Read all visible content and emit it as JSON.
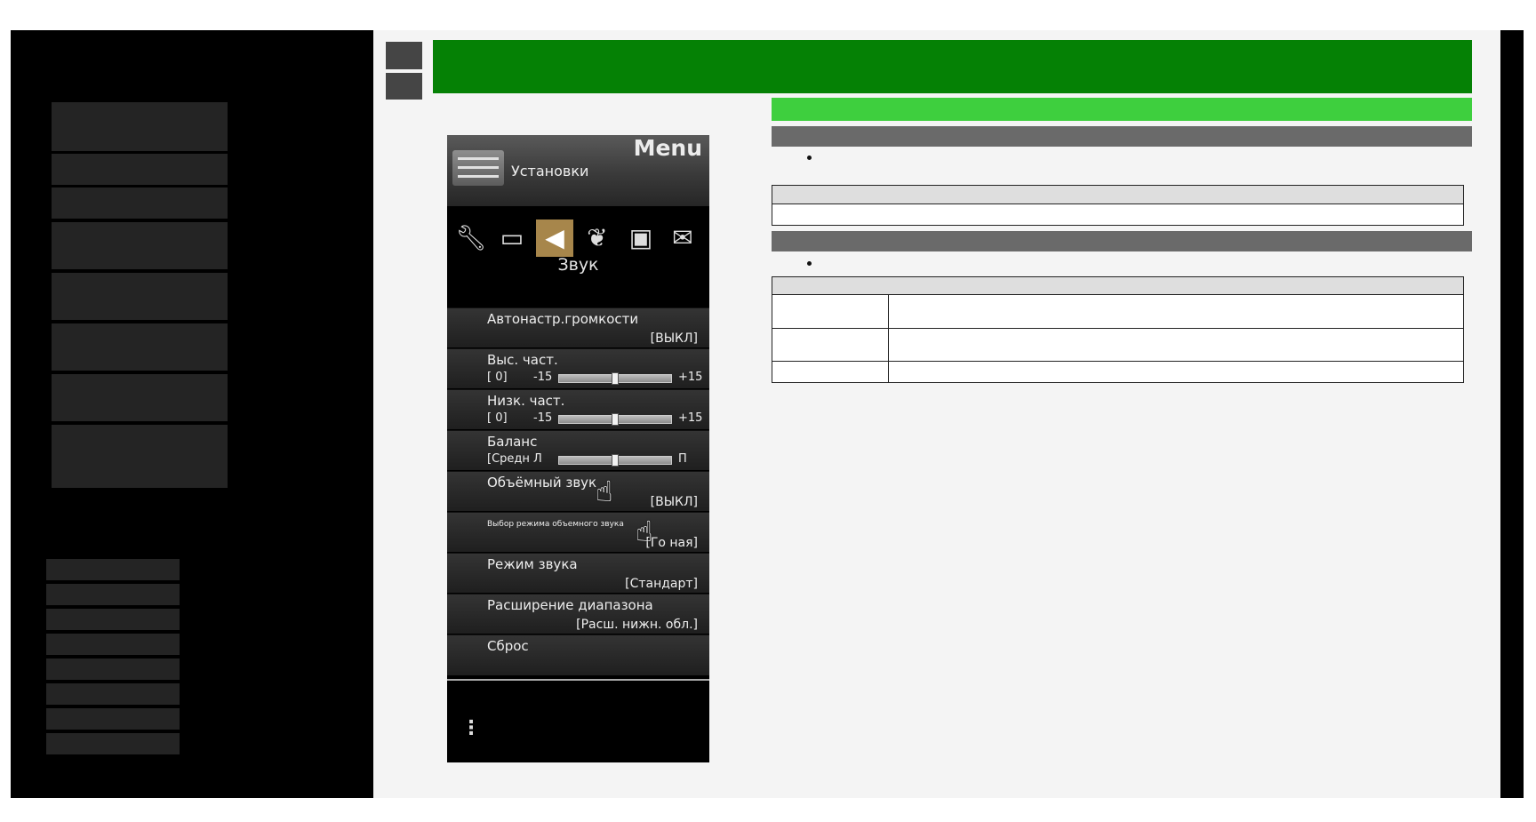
{
  "tv_menu": {
    "header_label": "Menu",
    "settings_label": "Установки",
    "category_label": "Звук",
    "icons": [
      "wrench-icon",
      "monitor-icon",
      "speaker-icon",
      "leaf-icon",
      "briefcase-icon",
      "mail-icon"
    ],
    "items": [
      {
        "title": "Автонастр.громкости",
        "value": "[ВЫКЛ]"
      },
      {
        "title": "Выс. част.",
        "slider": {
          "label": "[    0]",
          "min": "-15",
          "max": "+15",
          "level": 0.5
        }
      },
      {
        "title": "Низк. част.",
        "slider": {
          "label": "[    0]",
          "min": "-15",
          "max": "+15",
          "level": 0.5
        }
      },
      {
        "title": "Баланс",
        "slider": {
          "label": "[Средн",
          "min": "Л",
          "max": "П",
          "level": 0.5
        }
      },
      {
        "title": "Объёмный звук",
        "value": "[ВЫКЛ]"
      },
      {
        "title": "Выбор режима объемного звука",
        "value": "[Го     ная]"
      },
      {
        "title": "Режим звука",
        "value": "[Стандарт]"
      },
      {
        "title": "Расширение диапазона",
        "value": "[Расш. нижн. обл.]"
      },
      {
        "title": "Сброс",
        "value": ""
      }
    ]
  },
  "colors": {
    "frame": "#000000",
    "content_bg": "#f4f4f4",
    "title_bar_green": "#058105",
    "subtitle_bar_green": "#3ecf3e",
    "section_bar_gray": "#6a6a6a",
    "tv_active_icon": "#a7864b"
  }
}
